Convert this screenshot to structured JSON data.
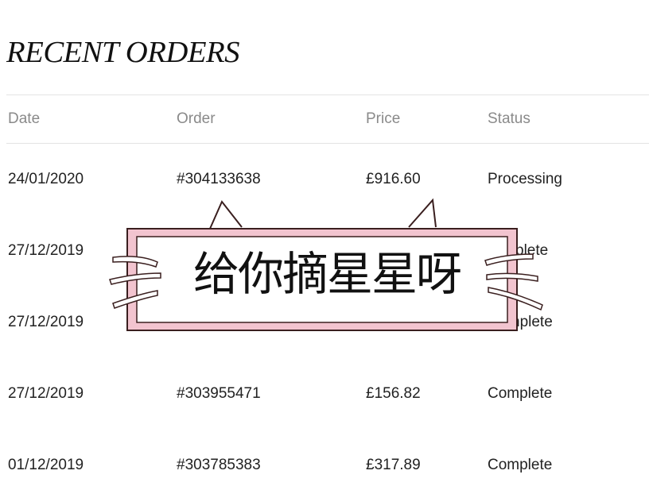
{
  "page": {
    "title": "RECENT ORDERS"
  },
  "table": {
    "headers": {
      "date": "Date",
      "order": "Order",
      "price": "Price",
      "status": "Status"
    },
    "rows": [
      {
        "date": "24/01/2020",
        "order": "#304133638",
        "price": "£916.60",
        "status": "Processing"
      },
      {
        "date": "27/12/2019",
        "order": "",
        "price": "",
        "status": "plete"
      },
      {
        "date": "27/12/2019",
        "order": "",
        "price": "",
        "status": "nplete"
      },
      {
        "date": "27/12/2019",
        "order": "#303955471",
        "price": "£156.82",
        "status": "Complete"
      },
      {
        "date": "01/12/2019",
        "order": "#303785383",
        "price": "£317.89",
        "status": "Complete"
      }
    ]
  },
  "sticker": {
    "text": "给你摘星星呀",
    "border_color": "#f2c4cf",
    "outline_color": "#3a1f1f"
  }
}
